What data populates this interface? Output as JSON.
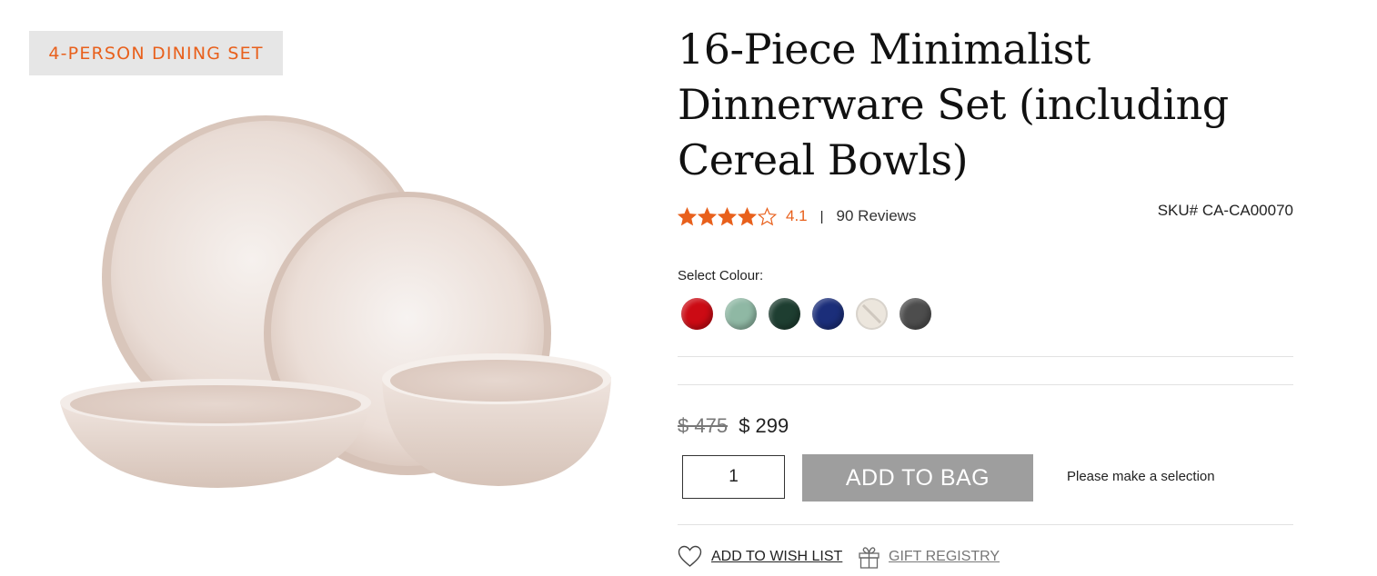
{
  "badge": {
    "text": "4-PERSON DINING SET",
    "color": "#e8601c"
  },
  "product": {
    "title": "16-Piece Minimalist Dinnerware Set (including Cereal Bowls)",
    "image_description_icon": "dinnerware-set-image",
    "rating": {
      "value": "4.1",
      "stars": 4.1,
      "max": 5,
      "separator": "|",
      "reviews": "90 Reviews"
    },
    "sku": "SKU# CA-CA00070"
  },
  "colour": {
    "label": "Select Colour:",
    "swatches": [
      {
        "name": "red",
        "color": "#cc0b14",
        "available": true
      },
      {
        "name": "sage",
        "color": "#8fb8a4",
        "available": true
      },
      {
        "name": "dark-green",
        "color": "#1e3e31",
        "available": true
      },
      {
        "name": "navy",
        "color": "#1b2e7a",
        "available": true
      },
      {
        "name": "cream",
        "color": "#ece6dd",
        "available": false
      },
      {
        "name": "charcoal",
        "color": "#4d4d4d",
        "available": true
      }
    ]
  },
  "pricing": {
    "old_price": "$ 475",
    "new_price": "$ 299"
  },
  "cart": {
    "quantity": "1",
    "add_label": "ADD TO BAG",
    "add_color": "#9e9e9e",
    "message": "Please make a selection"
  },
  "actions": {
    "wishlist": "ADD TO WISH LIST",
    "registry": "GIFT REGISTRY"
  },
  "colors": {
    "accent": "#e8601c",
    "star": "#e8601c"
  }
}
